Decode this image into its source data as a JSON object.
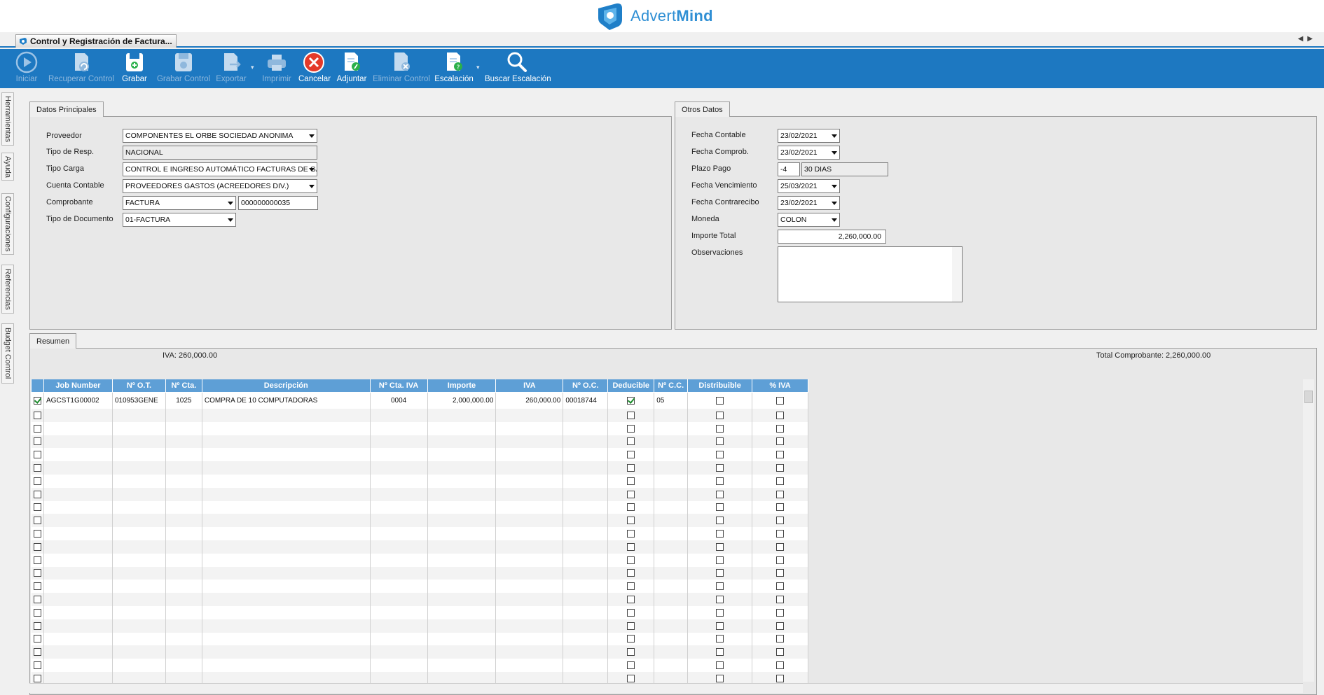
{
  "brand": {
    "name_light": "Advert",
    "name_bold": "Mind",
    "color": "#2f8fd4"
  },
  "window": {
    "tab_title": "Control y Registración de Factura..."
  },
  "toolbar": [
    {
      "label": "Iniciar",
      "icon": "play-icon",
      "enabled": false
    },
    {
      "label": "Recuperar Control",
      "icon": "recover-document-icon",
      "enabled": false
    },
    {
      "label": "Grabar",
      "icon": "save-icon",
      "enabled": true
    },
    {
      "label": "Grabar Control",
      "icon": "save-control-icon",
      "enabled": false
    },
    {
      "label": "Exportar",
      "icon": "export-icon",
      "enabled": false
    },
    {
      "label": "Imprimir",
      "icon": "printer-icon",
      "enabled": false
    },
    {
      "label": "Cancelar",
      "icon": "cancel-icon",
      "enabled": true
    },
    {
      "label": "Adjuntar",
      "icon": "attach-document-icon",
      "enabled": true
    },
    {
      "label": "Eliminar Control",
      "icon": "delete-document-icon",
      "enabled": false
    },
    {
      "label": "Escalación",
      "icon": "escalation-icon",
      "enabled": true
    },
    {
      "label": "Buscar Escalación",
      "icon": "search-icon",
      "enabled": true
    }
  ],
  "side_tabs": [
    "Herramientas",
    "Ayuda",
    "Configuraciones",
    "Referencias",
    "Budget Control"
  ],
  "datos_principales": {
    "title": "Datos Principales",
    "proveedor": {
      "label": "Proveedor",
      "value": "COMPONENTES EL ORBE SOCIEDAD ANONIMA"
    },
    "tipo_resp": {
      "label": "Tipo de Resp.",
      "value": "NACIONAL"
    },
    "tipo_carga": {
      "label": "Tipo Carga",
      "value": "CONTROL E INGRESO AUTOMÁTICO FACTURAS DE GAS"
    },
    "cuenta_contable": {
      "label": "Cuenta Contable",
      "value": "PROVEEDORES GASTOS (ACREEDORES DIV.)"
    },
    "comprobante": {
      "label": "Comprobante",
      "value": "FACTURA",
      "number": "000000000035"
    },
    "tipo_documento": {
      "label": "Tipo de Documento",
      "value": "01-FACTURA"
    }
  },
  "otros_datos": {
    "title": "Otros Datos",
    "fecha_contable": {
      "label": "Fecha Contable",
      "value": "23/02/2021"
    },
    "fecha_comprob": {
      "label": "Fecha Comprob.",
      "value": "23/02/2021"
    },
    "plazo_pago": {
      "label": "Plazo Pago",
      "code": "-4",
      "value": "30 DIAS"
    },
    "fecha_vencimiento": {
      "label": "Fecha Vencimiento",
      "value": "25/03/2021"
    },
    "fecha_contrarecibo": {
      "label": "Fecha Contrarecibo",
      "value": "23/02/2021"
    },
    "moneda": {
      "label": "Moneda",
      "value": "COLON"
    },
    "importe_total": {
      "label": "Importe Total",
      "value": "2,260,000.00"
    },
    "observaciones": {
      "label": "Observaciones",
      "value": ""
    }
  },
  "resumen": {
    "title": "Resumen",
    "iva_text": "IVA: 260,000.00",
    "total_text": "Total Comprobante: 2,260,000.00",
    "columns": [
      "Job Number",
      "Nº O.T.",
      "Nº Cta.",
      "Descripción",
      "Nº Cta. IVA",
      "Importe",
      "IVA",
      "Nº O.C.",
      "Deducible",
      "Nº C.C.",
      "Distribuible",
      "% IVA"
    ],
    "rows": [
      {
        "selected": true,
        "job_number": "AGCST1G00002",
        "ot": "010953GENE",
        "cta": "1025",
        "descripcion": "COMPRA DE 10 COMPUTADORAS",
        "cta_iva": "0004",
        "importe": "2,000,000.00",
        "iva": "260,000.00",
        "oc": "00018744",
        "deducible": true,
        "cc": "05",
        "distribuible": false,
        "pct_iva": false
      }
    ],
    "empty_rows": 21
  }
}
